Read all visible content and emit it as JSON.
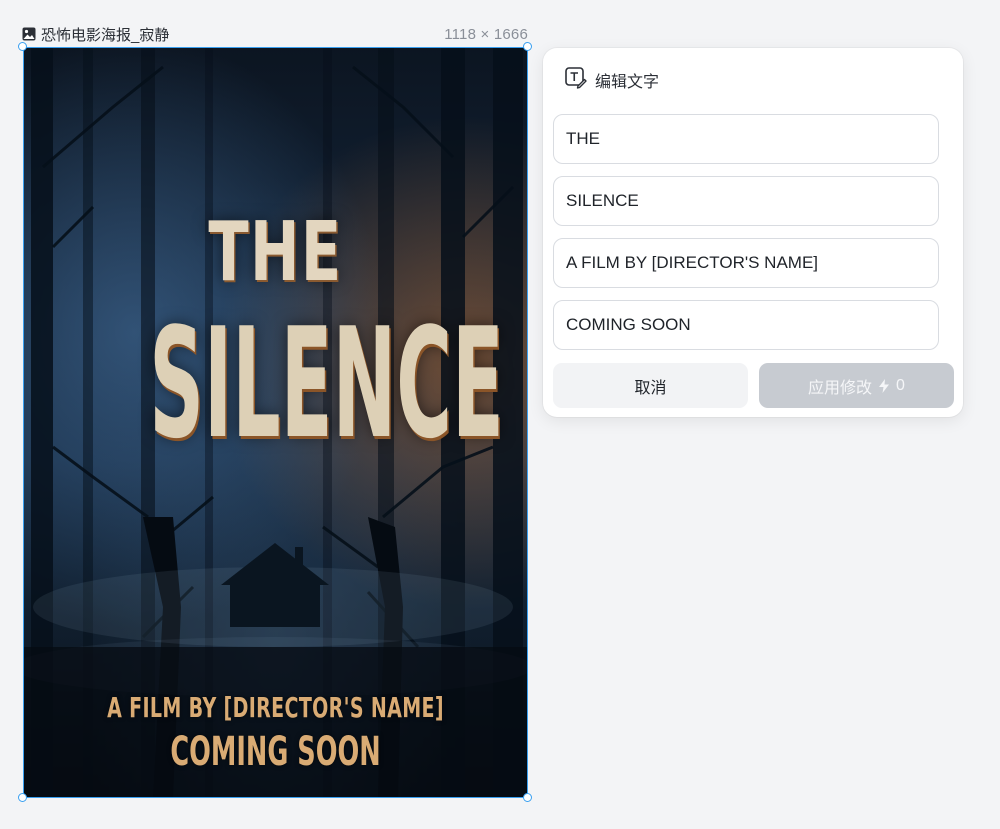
{
  "asset": {
    "title": "恐怖电影海报_寂静",
    "size": "1118 × 1666",
    "icon": "image-icon"
  },
  "poster": {
    "line1": "THE",
    "line2": "SILENCE",
    "line3": "A FILM BY [DIRECTOR'S NAME]",
    "line4": "COMING SOON"
  },
  "panel": {
    "title": "编辑文字",
    "icon": "text-edit-icon",
    "fields": [
      {
        "value": "THE"
      },
      {
        "value": "SILENCE"
      },
      {
        "value": "A FILM BY [DIRECTOR'S NAME]"
      },
      {
        "value": "COMING SOON"
      }
    ],
    "cancel_label": "取消",
    "apply_label": "应用修改",
    "apply_cost": "0",
    "apply_cost_icon": "bolt-icon"
  },
  "colors": {
    "selection": "#3aa0f0",
    "apply_disabled": "#c7cbd1",
    "poster_title": "#ddd0b6",
    "poster_credit": "#d9ab74"
  }
}
